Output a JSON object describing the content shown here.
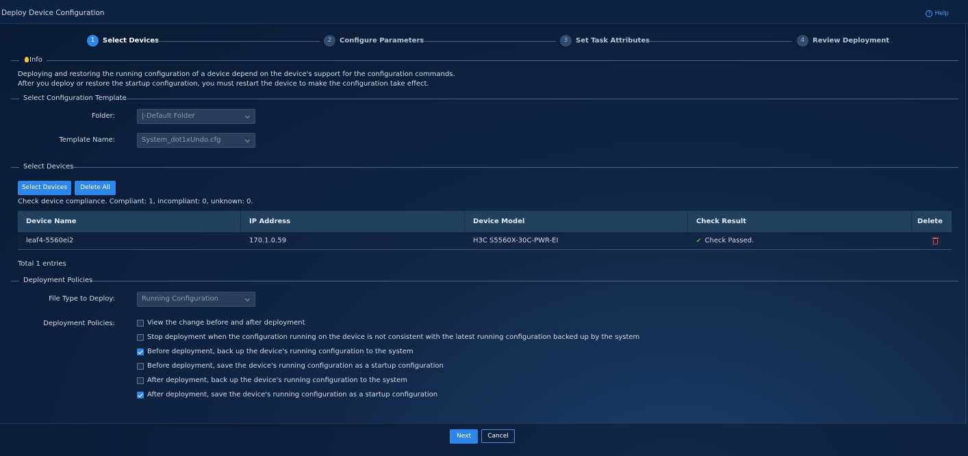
{
  "window": {
    "title": "Deploy Device Configuration",
    "help_label": "Help"
  },
  "steps": [
    {
      "num": "1",
      "label": "Select Devices"
    },
    {
      "num": "2",
      "label": "Configure Parameters"
    },
    {
      "num": "3",
      "label": "Set Task Attributes"
    },
    {
      "num": "4",
      "label": "Review Deployment"
    }
  ],
  "info": {
    "heading": "Info",
    "line1": "Deploying and restoring the running configuration of a device depend on the device's support for the configuration commands.",
    "line2": "After you deploy or restore the startup configuration, you must restart the device to make the configuration take effect."
  },
  "template": {
    "heading": "Select Configuration Template",
    "folder_label": "Folder:",
    "folder_value": "|-Default Folder",
    "name_label": "Template Name:",
    "name_value": "System_dot1xUndo.cfg"
  },
  "devices": {
    "heading": "Select Devices",
    "select_btn": "Select Devices",
    "delete_all_btn": "Delete All",
    "compliance": "Check device compliance. Compliant: 1, incompliant: 0, unknown: 0.",
    "columns": [
      "Device Name",
      "IP Address",
      "Device Model",
      "Check Result",
      "Delete"
    ],
    "rows": [
      {
        "name": "leaf4-5560ei2",
        "ip": "170.1.0.59",
        "model": "H3C S5560X-30C-PWR-EI",
        "result": "Check Passed."
      }
    ],
    "total": "Total 1 entries"
  },
  "policies": {
    "heading": "Deployment Policies",
    "file_type_label": "File Type to Deploy:",
    "file_type_value": "Running Configuration",
    "policies_label": "Deployment Policies:",
    "options": [
      {
        "label": "View the change before and after deployment",
        "checked": false
      },
      {
        "label": "Stop deployment when the configuration running on the device is not consistent with the latest running configuration backed up by the system",
        "checked": false
      },
      {
        "label": "Before deployment, back up the device's running configuration to the system",
        "checked": true
      },
      {
        "label": "Before deployment, save the device's running configuration as a startup configuration",
        "checked": false
      },
      {
        "label": "After deployment, back up the device's running configuration to the system",
        "checked": false
      },
      {
        "label": "After deployment, save the device's running configuration as a startup configuration",
        "checked": true
      }
    ]
  },
  "footer": {
    "next": "Next",
    "cancel": "Cancel"
  },
  "colors": {
    "accent": "#2e87e8",
    "success": "#52c41a",
    "danger": "#e84b4b"
  }
}
